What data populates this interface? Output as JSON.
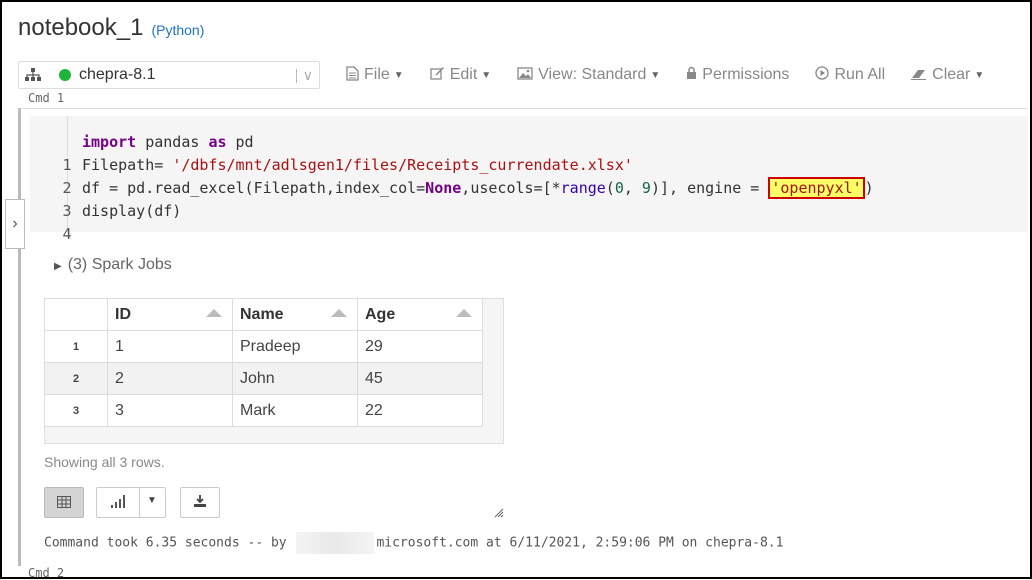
{
  "notebook": {
    "title": "notebook_1",
    "language": "(Python)"
  },
  "toolbar": {
    "cluster": "chepra-8.1",
    "file": "File",
    "edit": "Edit",
    "view": "View: Standard",
    "permissions": "Permissions",
    "run_all": "Run All",
    "clear": "Clear",
    "status_color": "#1eb53a"
  },
  "cells": {
    "cmd1": "Cmd 1",
    "cmd2": "Cmd 2"
  },
  "code": {
    "line_numbers": [
      "1",
      "2",
      "3",
      "4"
    ],
    "line1": {
      "kw1": "import",
      "t1": " pandas ",
      "kw2": "as",
      "t2": " pd"
    },
    "line2": {
      "t1": "Filepath= ",
      "str": "'/dbfs/mnt/adlsgen1/files/Receipts_currendate.xlsx'"
    },
    "line3": {
      "t1": "df = pd.read_excel(Filepath,index_col=",
      "none": "None",
      "t2": ",usecols=[*",
      "range": "range",
      "t3": "(",
      "n0": "0",
      "t4": ", ",
      "n9": "9",
      "t5": ")], engine = ",
      "engine": "'openpyxl'",
      "t6": ")"
    },
    "line4": {
      "t1": "display(df)"
    }
  },
  "spark_jobs": "(3) Spark Jobs",
  "table": {
    "headers": [
      "ID",
      "Name",
      "Age"
    ],
    "rows": [
      {
        "n": "1",
        "id": "1",
        "name": "Pradeep",
        "age": "29"
      },
      {
        "n": "2",
        "id": "2",
        "name": "John",
        "age": "45"
      },
      {
        "n": "3",
        "id": "3",
        "name": "Mark",
        "age": "22"
      }
    ]
  },
  "showing": "Showing all 3 rows.",
  "command_took": {
    "prefix": "Command took 6.35 seconds -- by ",
    "suffix": "microsoft.com at 6/11/2021, 2:59:06 PM on chepra-8.1"
  },
  "icons": [
    "cluster-tree-icon",
    "file-icon",
    "edit-icon",
    "image-icon",
    "lock-icon",
    "play-icon",
    "eraser-icon",
    "table-icon",
    "bar-chart-icon",
    "download-icon",
    "chevron-right-icon"
  ]
}
